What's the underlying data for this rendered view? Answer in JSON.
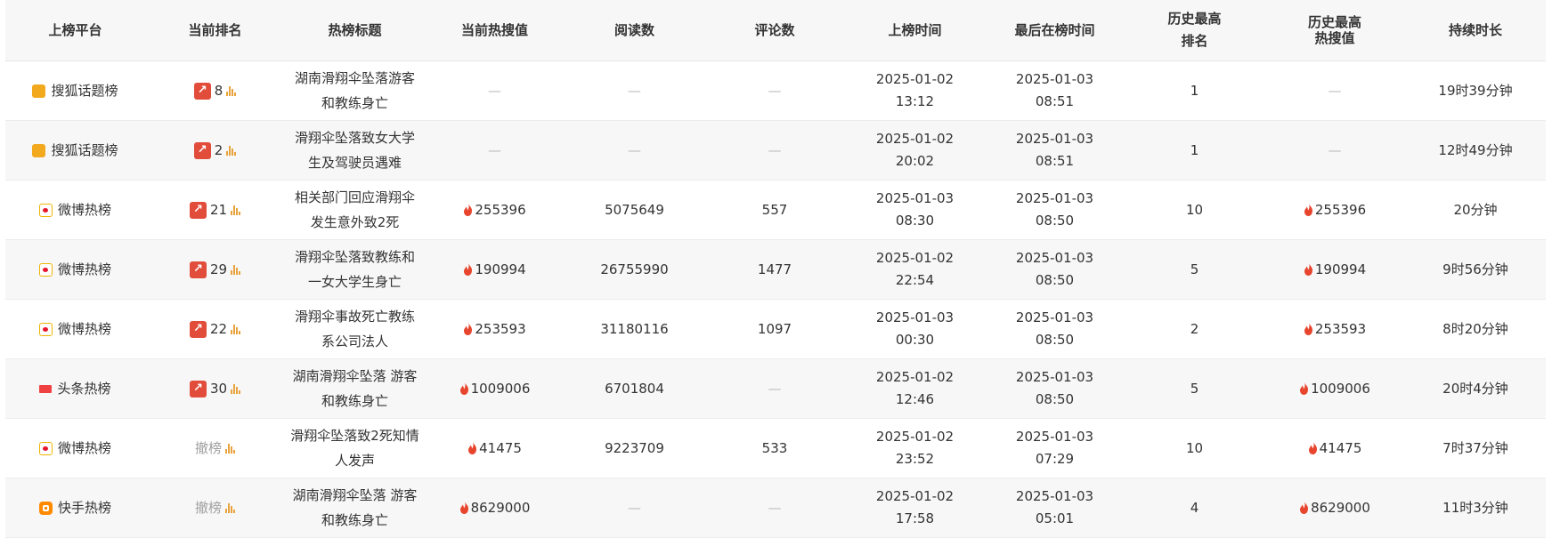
{
  "columns": {
    "platform": "上榜平台",
    "rank": "当前排名",
    "title": "热榜标题",
    "hot_value": "当前热搜值",
    "reads": "阅读数",
    "comments": "评论数",
    "on_time": "上榜时间",
    "last_time": "最后在榜时间",
    "best_rank_l1": "历史最高",
    "best_rank_l2": "排名",
    "best_hot_l1": "历史最高",
    "best_hot_l2": "热搜值",
    "duration": "持续时长"
  },
  "dash": "—",
  "rows": [
    {
      "platform": "搜狐话题榜",
      "platform_icon": "sohu-icon",
      "rank": "8",
      "title": "湖南滑翔伞坠落游客和教练身亡",
      "hot": "",
      "reads": "",
      "comments": "",
      "on_date": "2025-01-02",
      "on_time": "13:12",
      "last_date": "2025-01-03",
      "last_time": "08:51",
      "best_rank": "1",
      "best_hot": "",
      "duration": "19时39分钟"
    },
    {
      "platform": "搜狐话题榜",
      "platform_icon": "sohu-icon",
      "rank": "2",
      "title": "滑翔伞坠落致女大学生及驾驶员遇难",
      "hot": "",
      "reads": "",
      "comments": "",
      "on_date": "2025-01-02",
      "on_time": "20:02",
      "last_date": "2025-01-03",
      "last_time": "08:51",
      "best_rank": "1",
      "best_hot": "",
      "duration": "12时49分钟"
    },
    {
      "platform": "微博热榜",
      "platform_icon": "weibo-icon",
      "rank": "21",
      "title": "相关部门回应滑翔伞发生意外致2死",
      "hot": "255396",
      "reads": "5075649",
      "comments": "557",
      "on_date": "2025-01-03",
      "on_time": "08:30",
      "last_date": "2025-01-03",
      "last_time": "08:50",
      "best_rank": "10",
      "best_hot": "255396",
      "duration": "20分钟"
    },
    {
      "platform": "微博热榜",
      "platform_icon": "weibo-icon",
      "rank": "29",
      "title": "滑翔伞坠落致教练和一女大学生身亡",
      "hot": "190994",
      "reads": "26755990",
      "comments": "1477",
      "on_date": "2025-01-02",
      "on_time": "22:54",
      "last_date": "2025-01-03",
      "last_time": "08:50",
      "best_rank": "5",
      "best_hot": "190994",
      "duration": "9时56分钟"
    },
    {
      "platform": "微博热榜",
      "platform_icon": "weibo-icon",
      "rank": "22",
      "title": "滑翔伞事故死亡教练系公司法人",
      "hot": "253593",
      "reads": "31180116",
      "comments": "1097",
      "on_date": "2025-01-03",
      "on_time": "00:30",
      "last_date": "2025-01-03",
      "last_time": "08:50",
      "best_rank": "2",
      "best_hot": "253593",
      "duration": "8时20分钟"
    },
    {
      "platform": "头条热榜",
      "platform_icon": "toutiao-icon",
      "rank": "30",
      "title": "湖南滑翔伞坠落 游客和教练身亡",
      "hot": "1009006",
      "reads": "6701804",
      "comments": "",
      "on_date": "2025-01-02",
      "on_time": "12:46",
      "last_date": "2025-01-03",
      "last_time": "08:50",
      "best_rank": "5",
      "best_hot": "1009006",
      "duration": "20时4分钟"
    },
    {
      "platform": "微博热榜",
      "platform_icon": "weibo-icon",
      "rank": "撤榜",
      "title": "滑翔伞坠落致2死知情人发声",
      "hot": "41475",
      "reads": "9223709",
      "comments": "533",
      "on_date": "2025-01-02",
      "on_time": "23:52",
      "last_date": "2025-01-03",
      "last_time": "07:29",
      "best_rank": "10",
      "best_hot": "41475",
      "duration": "7时37分钟"
    },
    {
      "platform": "快手热榜",
      "platform_icon": "kuaishou-icon",
      "rank": "撤榜",
      "title": "湖南滑翔伞坠落 游客和教练身亡",
      "hot": "8629000",
      "reads": "",
      "comments": "",
      "on_date": "2025-01-02",
      "on_time": "17:58",
      "last_date": "2025-01-03",
      "last_time": "05:01",
      "best_rank": "4",
      "best_hot": "8629000",
      "duration": "11时3分钟"
    }
  ]
}
